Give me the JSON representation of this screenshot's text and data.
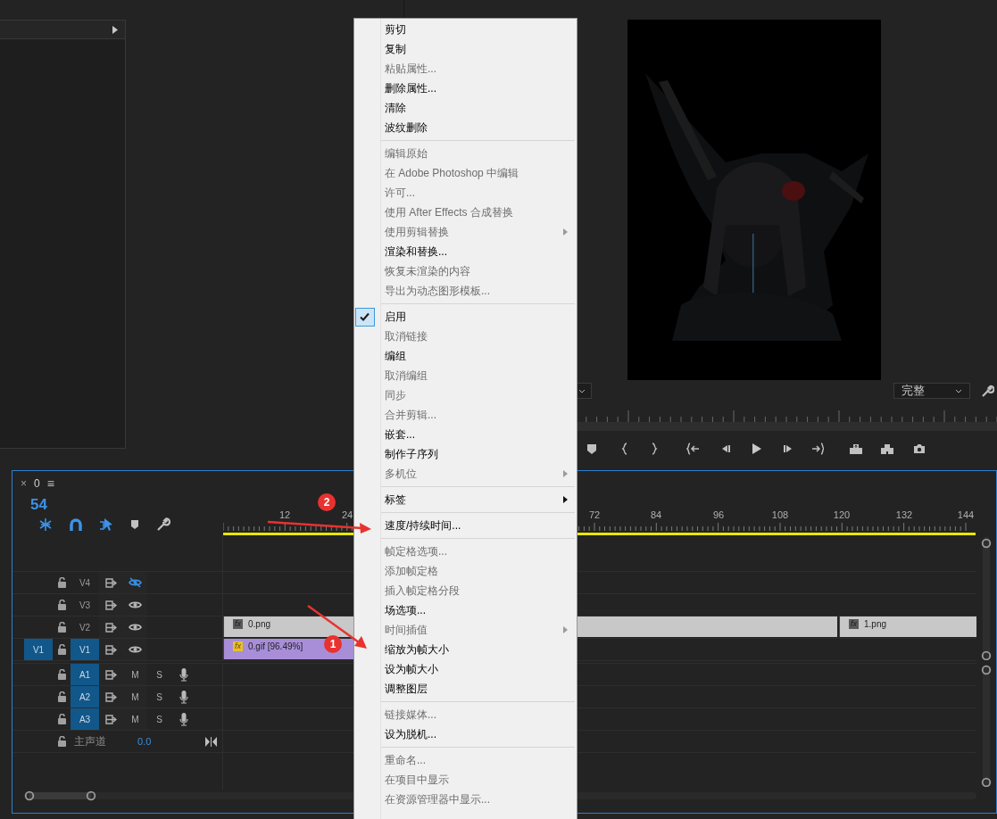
{
  "program_monitor": {
    "quality_dropdown": {
      "value": "完整"
    }
  },
  "context_menu": {
    "items": [
      {
        "kind": "item",
        "label": "剪切",
        "disabled": false,
        "checked": false,
        "submenu": false
      },
      {
        "kind": "item",
        "label": "复制",
        "disabled": false,
        "checked": false,
        "submenu": false
      },
      {
        "kind": "item",
        "label": "粘贴属性...",
        "disabled": true,
        "checked": false,
        "submenu": false
      },
      {
        "kind": "item",
        "label": "删除属性...",
        "disabled": false,
        "checked": false,
        "submenu": false
      },
      {
        "kind": "item",
        "label": "清除",
        "disabled": false,
        "checked": false,
        "submenu": false
      },
      {
        "kind": "item",
        "label": "波纹删除",
        "disabled": false,
        "checked": false,
        "submenu": false
      },
      {
        "kind": "separator"
      },
      {
        "kind": "item",
        "label": "编辑原始",
        "disabled": true,
        "checked": false,
        "submenu": false
      },
      {
        "kind": "item",
        "label": "在 Adobe Photoshop 中编辑",
        "disabled": true,
        "checked": false,
        "submenu": false
      },
      {
        "kind": "item",
        "label": "许可...",
        "disabled": true,
        "checked": false,
        "submenu": false
      },
      {
        "kind": "item",
        "label": "使用 After Effects 合成替换",
        "disabled": true,
        "checked": false,
        "submenu": false
      },
      {
        "kind": "item",
        "label": "使用剪辑替换",
        "disabled": true,
        "checked": false,
        "submenu": true
      },
      {
        "kind": "item",
        "label": "渲染和替换...",
        "disabled": false,
        "checked": false,
        "submenu": false
      },
      {
        "kind": "item",
        "label": "恢复未渲染的内容",
        "disabled": true,
        "checked": false,
        "submenu": false
      },
      {
        "kind": "item",
        "label": "导出为动态图形模板...",
        "disabled": true,
        "checked": false,
        "submenu": false
      },
      {
        "kind": "separator"
      },
      {
        "kind": "item",
        "label": "启用",
        "disabled": false,
        "checked": true,
        "submenu": false
      },
      {
        "kind": "item",
        "label": "取消链接",
        "disabled": true,
        "checked": false,
        "submenu": false
      },
      {
        "kind": "item",
        "label": "编组",
        "disabled": false,
        "checked": false,
        "submenu": false
      },
      {
        "kind": "item",
        "label": "取消编组",
        "disabled": true,
        "checked": false,
        "submenu": false
      },
      {
        "kind": "item",
        "label": "同步",
        "disabled": true,
        "checked": false,
        "submenu": false
      },
      {
        "kind": "item",
        "label": "合并剪辑...",
        "disabled": true,
        "checked": false,
        "submenu": false
      },
      {
        "kind": "item",
        "label": "嵌套...",
        "disabled": false,
        "checked": false,
        "submenu": false
      },
      {
        "kind": "item",
        "label": "制作子序列",
        "disabled": false,
        "checked": false,
        "submenu": false
      },
      {
        "kind": "item",
        "label": "多机位",
        "disabled": true,
        "checked": false,
        "submenu": true
      },
      {
        "kind": "separator"
      },
      {
        "kind": "item",
        "label": "标签",
        "disabled": false,
        "checked": false,
        "submenu": true
      },
      {
        "kind": "separator"
      },
      {
        "kind": "item",
        "label": "速度/持续时间...",
        "disabled": false,
        "checked": false,
        "submenu": false
      },
      {
        "kind": "separator"
      },
      {
        "kind": "item",
        "label": "帧定格选项...",
        "disabled": true,
        "checked": false,
        "submenu": false
      },
      {
        "kind": "item",
        "label": "添加帧定格",
        "disabled": true,
        "checked": false,
        "submenu": false
      },
      {
        "kind": "item",
        "label": "插入帧定格分段",
        "disabled": true,
        "checked": false,
        "submenu": false
      },
      {
        "kind": "item",
        "label": "场选项...",
        "disabled": false,
        "checked": false,
        "submenu": false
      },
      {
        "kind": "item",
        "label": "时间插值",
        "disabled": true,
        "checked": false,
        "submenu": true
      },
      {
        "kind": "item",
        "label": "缩放为帧大小",
        "disabled": false,
        "checked": false,
        "submenu": false
      },
      {
        "kind": "item",
        "label": "设为帧大小",
        "disabled": false,
        "checked": false,
        "submenu": false
      },
      {
        "kind": "item",
        "label": "调整图层",
        "disabled": false,
        "checked": false,
        "submenu": false
      },
      {
        "kind": "separator"
      },
      {
        "kind": "item",
        "label": "链接媒体...",
        "disabled": true,
        "checked": false,
        "submenu": false
      },
      {
        "kind": "item",
        "label": "设为脱机...",
        "disabled": false,
        "checked": false,
        "submenu": false
      },
      {
        "kind": "separator"
      },
      {
        "kind": "item",
        "label": "重命名...",
        "disabled": true,
        "checked": false,
        "submenu": false
      },
      {
        "kind": "item",
        "label": "在项目中显示",
        "disabled": true,
        "checked": false,
        "submenu": false
      },
      {
        "kind": "item",
        "label": "在资源管理器中显示...",
        "disabled": true,
        "checked": false,
        "submenu": false
      }
    ]
  },
  "timeline": {
    "close": "×",
    "sequence_name": "0",
    "panel_menu": "≡",
    "timecode": "54",
    "ruler_labels": [
      "12",
      "24",
      "72",
      "84",
      "96",
      "108",
      "120",
      "132",
      "144"
    ],
    "video_tracks": [
      {
        "name": "V4",
        "targeted": false,
        "visible": false
      },
      {
        "name": "V3",
        "targeted": false,
        "visible": true
      },
      {
        "name": "V2",
        "targeted": false,
        "visible": true,
        "clips": [
          {
            "badge": "fx",
            "name": "0.png"
          },
          {
            "badge": "fx",
            "name": "1.png"
          }
        ]
      },
      {
        "name": "V1",
        "source_patch": "V1",
        "targeted": true,
        "visible": true,
        "clips": [
          {
            "kind": "gif",
            "badge": "fx",
            "name": "0.gif [96.49%]"
          }
        ]
      }
    ],
    "audio_tracks": [
      {
        "name": "A1",
        "targeted": true,
        "mute": "M",
        "solo": "S"
      },
      {
        "name": "A2",
        "targeted": true,
        "mute": "M",
        "solo": "S"
      },
      {
        "name": "A3",
        "targeted": true,
        "mute": "M",
        "solo": "S"
      }
    ],
    "master": {
      "label": "主声道",
      "value": "0.0"
    }
  },
  "annotations": [
    {
      "number": "2"
    },
    {
      "number": "1"
    }
  ]
}
